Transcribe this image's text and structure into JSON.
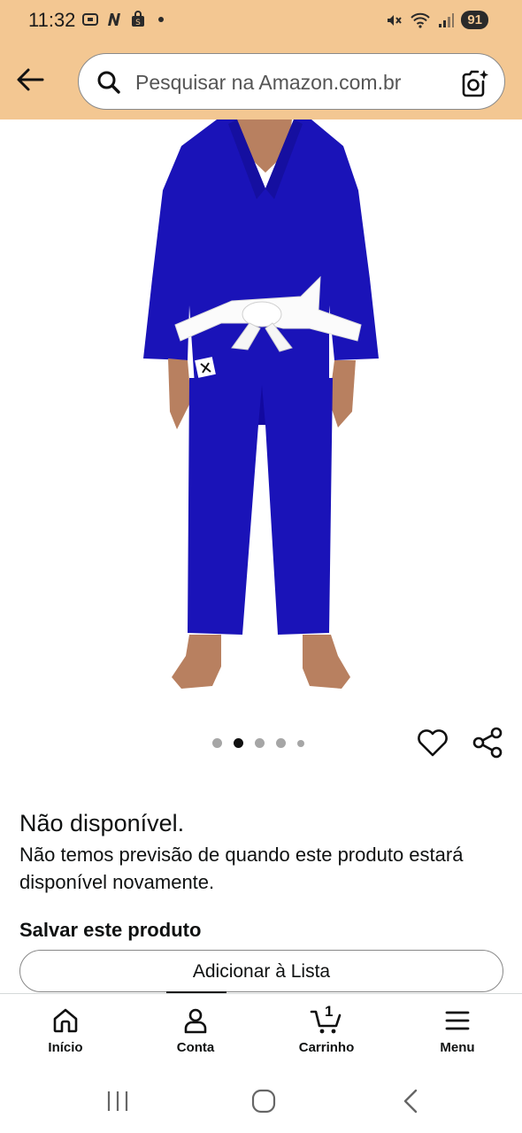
{
  "status_bar": {
    "time": "11:32",
    "battery": "91"
  },
  "search": {
    "placeholder": "Pesquisar na Amazon.com.br"
  },
  "icons": {
    "back": "arrow-left-icon",
    "search": "search-icon",
    "camera": "camera-search-icon",
    "heart": "heart-icon",
    "share": "share-icon"
  },
  "product": {
    "image_index": 2,
    "image_count": 5,
    "availability_title": "Não disponível.",
    "availability_desc": "Não temos previsão de quando este produto estará disponível novamente.",
    "save_title": "Salvar este produto",
    "add_to_list_label": "Adicionar à Lista",
    "gi_color": "#1a13b8"
  },
  "bottom_nav": {
    "items": [
      {
        "label": "Início",
        "icon": "home-icon"
      },
      {
        "label": "Conta",
        "icon": "account-icon"
      },
      {
        "label": "Carrinho",
        "icon": "cart-icon",
        "badge": "1"
      },
      {
        "label": "Menu",
        "icon": "menu-icon"
      }
    ]
  },
  "colors": {
    "header_bg": "#f3c792",
    "text": "#0f1111"
  }
}
